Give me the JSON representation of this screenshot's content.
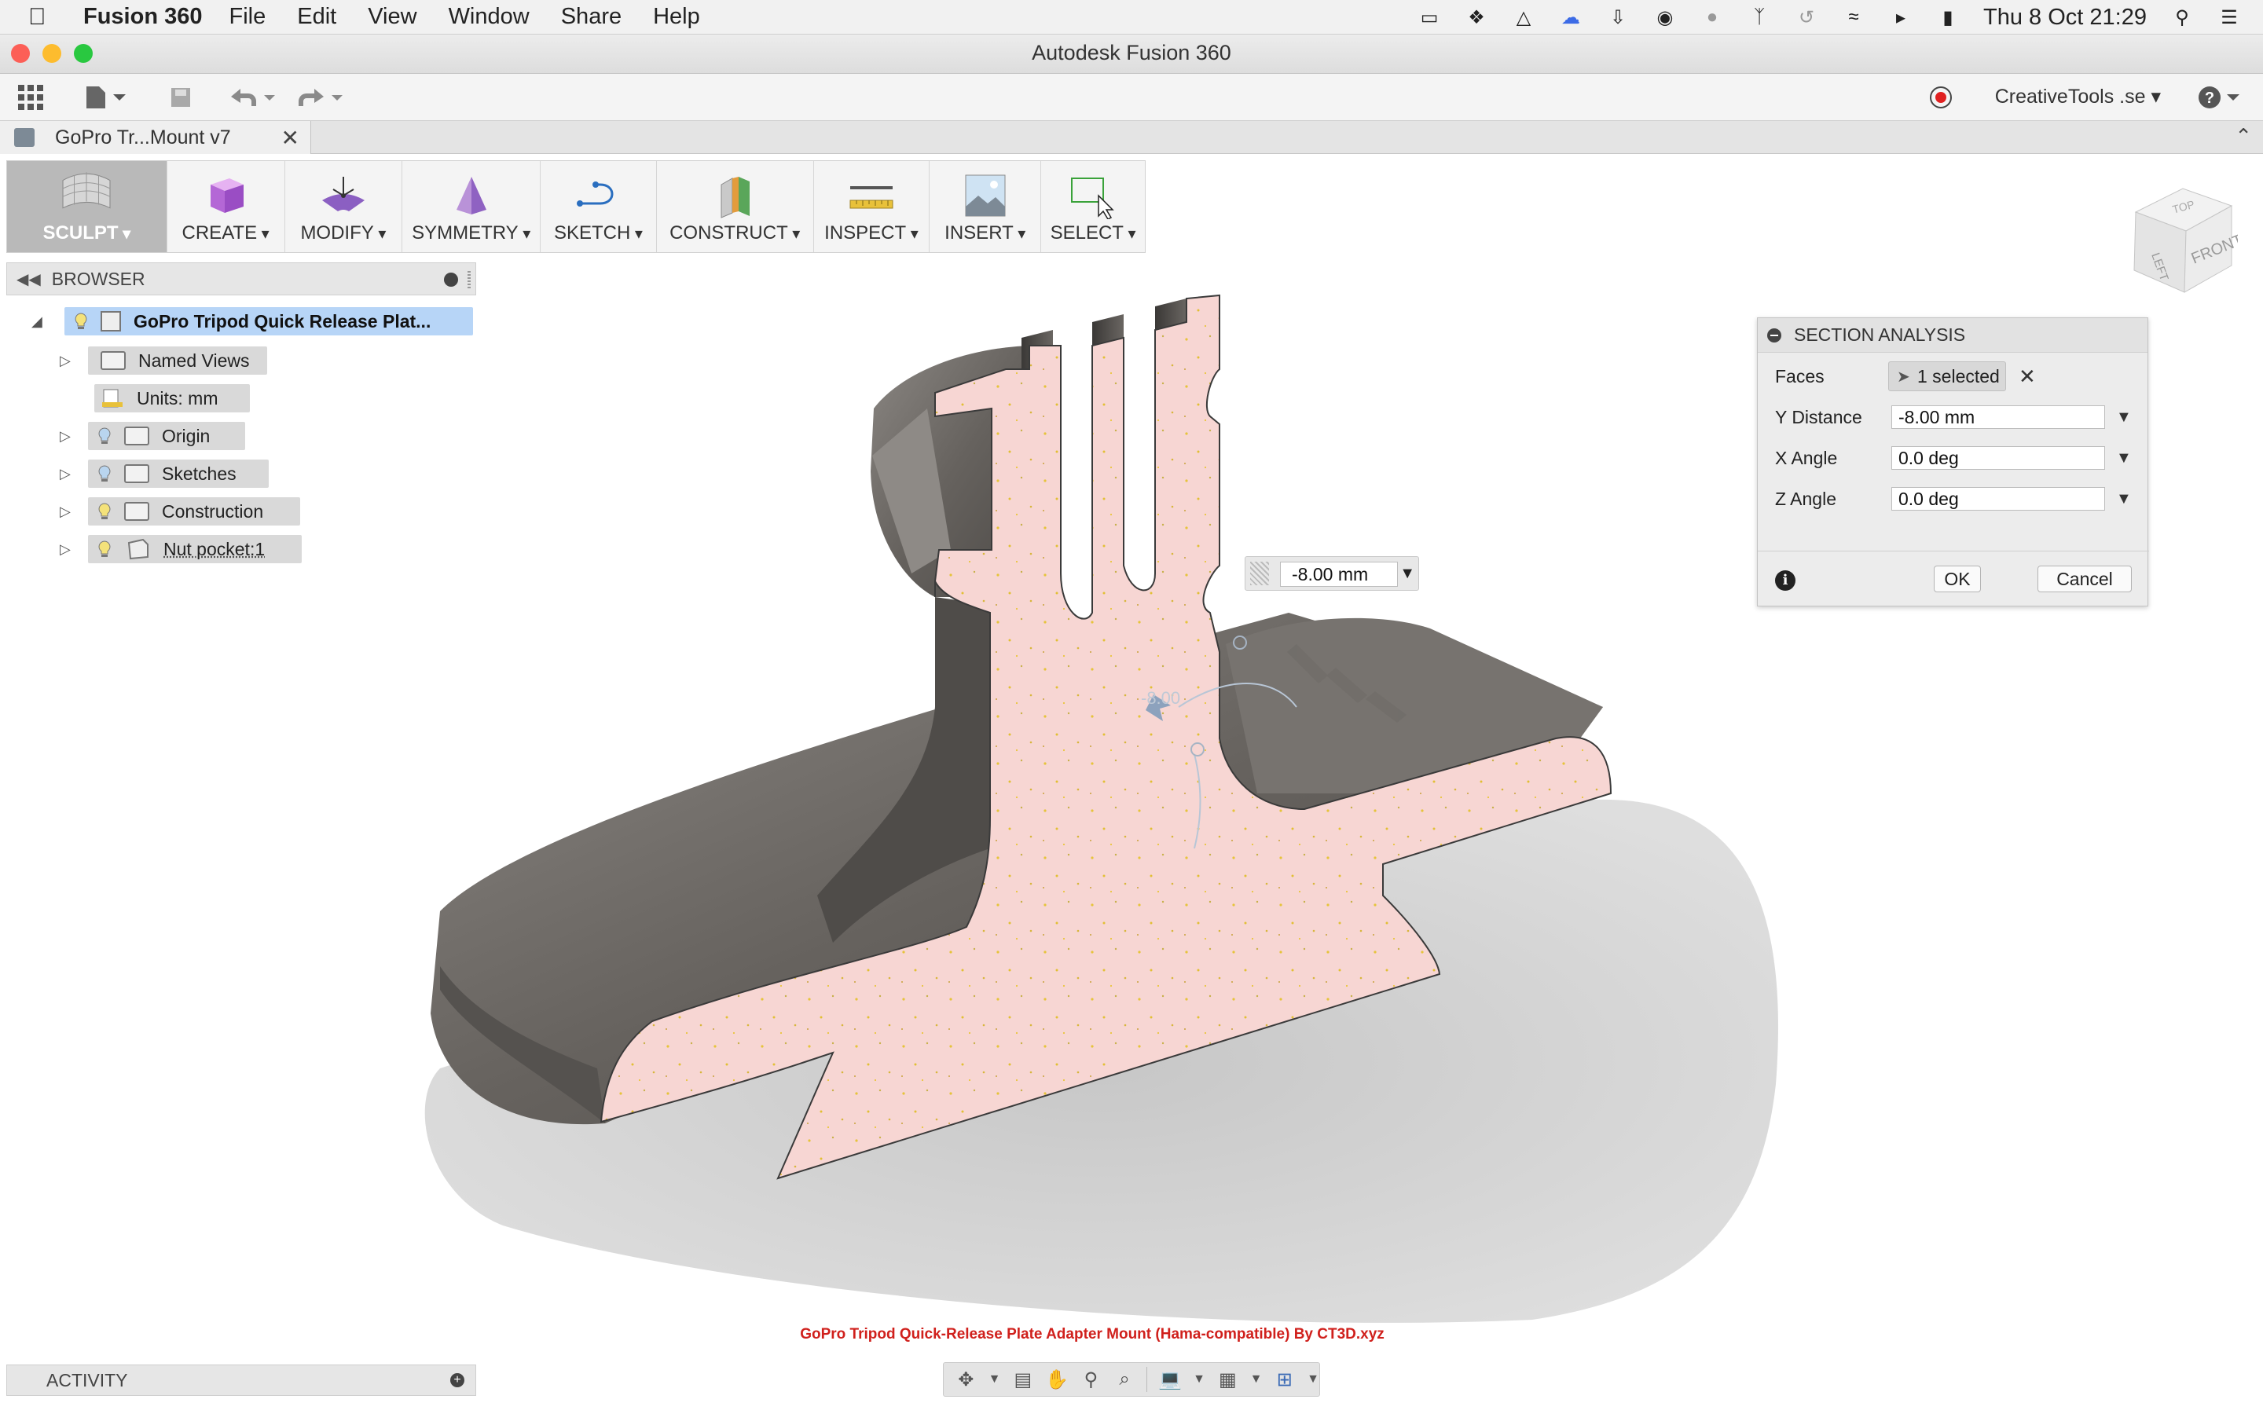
{
  "menubar": {
    "app_name": "Fusion 360",
    "items": [
      "File",
      "Edit",
      "View",
      "Window",
      "Share",
      "Help"
    ],
    "clock": "Thu 8 Oct  21:29",
    "status_icons": [
      "airplay-icon",
      "dropbox-icon",
      "drive-icon",
      "creative-cloud-icon",
      "download-icon",
      "record-icon",
      "notification-icon",
      "bluetooth-icon",
      "time-machine-icon",
      "wifi-icon",
      "volume-icon",
      "battery-icon",
      "spotlight-icon",
      "notification-center-icon"
    ]
  },
  "window": {
    "title": "Autodesk Fusion 360"
  },
  "toolbar": {
    "user": "CreativeTools .se"
  },
  "document_tab": {
    "name": "GoPro Tr...Mount v7"
  },
  "ribbon": {
    "workspace": "SCULPT",
    "groups": [
      "CREATE",
      "MODIFY",
      "SYMMETRY",
      "SKETCH",
      "CONSTRUCT",
      "INSPECT",
      "INSERT",
      "SELECT"
    ]
  },
  "browser": {
    "title": "BROWSER",
    "root": "GoPro Tripod Quick Release Plat...",
    "items": [
      {
        "label": "Named Views"
      },
      {
        "label": "Units: mm"
      },
      {
        "label": "Origin"
      },
      {
        "label": "Sketches"
      },
      {
        "label": "Construction"
      },
      {
        "label": "Nut pocket:1"
      }
    ]
  },
  "activity": {
    "label": "ACTIVITY"
  },
  "section_analysis": {
    "title": "SECTION ANALYSIS",
    "faces_label": "Faces",
    "faces_value": "1 selected",
    "y_distance_label": "Y Distance",
    "y_distance_value": "-8.00 mm",
    "x_angle_label": "X Angle",
    "x_angle_value": "0.0 deg",
    "z_angle_label": "Z Angle",
    "z_angle_value": "0.0 deg",
    "ok": "OK",
    "cancel": "Cancel"
  },
  "manipulator": {
    "value": "-8.00 mm",
    "ghost_label": "-8.00"
  },
  "viewcube": {
    "top": "TOP",
    "front": "FRONT",
    "left": "LEFT"
  },
  "caption": "GoPro Tripod Quick-Release Plate Adapter Mount (Hama-compatible) By CT3D.xyz",
  "colors": {
    "section_fill": "#f6d3d0",
    "body_gray": "#6e6a66",
    "browser_highlight": "#b7d5f7",
    "caption_red": "#d0201c"
  }
}
